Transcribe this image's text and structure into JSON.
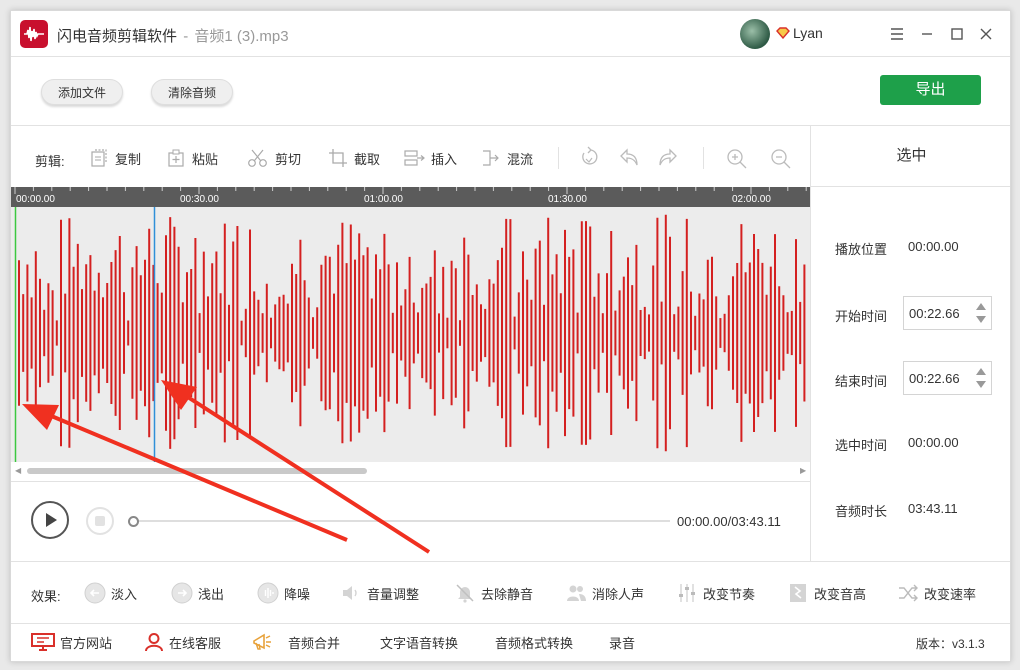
{
  "titlebar": {
    "app_name": "闪电音频剪辑软件",
    "separator": "-",
    "file_name": "音频1 (3).mp3",
    "user_name": "Lyan"
  },
  "actions": {
    "add_file": "添加文件",
    "clear_audio": "清除音频",
    "export": "导出"
  },
  "toolbar": {
    "label": "剪辑:",
    "items": [
      "复制",
      "粘贴",
      "剪切",
      "截取",
      "插入",
      "混流"
    ]
  },
  "timeline": {
    "ticks": [
      "00:00.00",
      "00:30.00",
      "01:00.00",
      "01:30.00",
      "02:00.00"
    ]
  },
  "player": {
    "time_readout": "00:00.00/03:43.11",
    "progress": 0.0
  },
  "side_panel": {
    "title": "选中",
    "play_position_label": "播放位置",
    "play_position_value": "00:00.00",
    "start_label": "开始时间",
    "start_value": "00:22.66",
    "end_label": "结束时间",
    "end_value": "00:22.66",
    "selected_label": "选中时间",
    "selected_value": "00:00.00",
    "duration_label": "音频时长",
    "duration_value": "03:43.11"
  },
  "effects": {
    "label": "效果:",
    "items": [
      "淡入",
      "浅出",
      "降噪",
      "音量调整",
      "去除静音",
      "消除人声",
      "改变节奏",
      "改变音高",
      "改变速率"
    ]
  },
  "bottom": {
    "links": [
      "官方网站",
      "在线客服",
      "音频合并",
      "文字语音转换",
      "音频格式转换",
      "录音"
    ],
    "version": "版本：v3.1.3"
  },
  "colors": {
    "accent_green": "#1ea04a",
    "waveform_red": "#d42020",
    "cursor_blue": "#2f8fd8",
    "start_marker_green": "#3cc840",
    "annotation_red": "#f03020"
  }
}
